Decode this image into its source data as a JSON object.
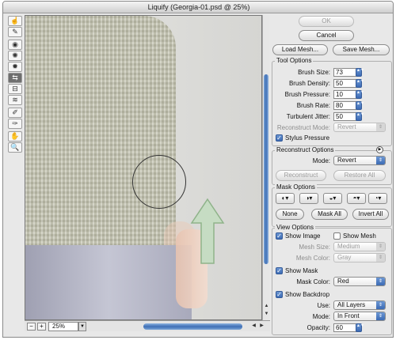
{
  "window": {
    "title": "Liquify (Georgia-01.psd @ 25%)"
  },
  "tools": [
    {
      "icon": "forward-warp-icon",
      "glyph": "☝"
    },
    {
      "icon": "reconstruct-tool-icon",
      "glyph": "✎"
    },
    {
      "icon": "twirl-clockwise-icon",
      "glyph": "◉"
    },
    {
      "icon": "pucker-icon",
      "glyph": "✺"
    },
    {
      "icon": "bloat-icon",
      "glyph": "✹"
    },
    {
      "icon": "push-left-icon",
      "glyph": "⇆"
    },
    {
      "icon": "mirror-icon",
      "glyph": "⊟"
    },
    {
      "icon": "turbulence-icon",
      "glyph": "≋"
    },
    {
      "icon": "freeze-mask-icon",
      "glyph": "✐"
    },
    {
      "icon": "thaw-mask-icon",
      "glyph": "✑"
    },
    {
      "icon": "hand-icon",
      "glyph": "✋"
    },
    {
      "icon": "zoom-icon",
      "glyph": "🔍"
    }
  ],
  "buttons": {
    "ok": "OK",
    "cancel": "Cancel",
    "load_mesh": "Load Mesh...",
    "save_mesh": "Save Mesh..."
  },
  "tool_options": {
    "title": "Tool Options",
    "brush_size_label": "Brush Size:",
    "brush_size": "73",
    "brush_density_label": "Brush Density:",
    "brush_density": "50",
    "brush_pressure_label": "Brush Pressure:",
    "brush_pressure": "10",
    "brush_rate_label": "Brush Rate:",
    "brush_rate": "80",
    "turbulent_jitter_label": "Turbulent Jitter:",
    "turbulent_jitter": "50",
    "reconstruct_mode_label": "Reconstruct Mode:",
    "reconstruct_mode": "Revert",
    "stylus_pressure_label": "Stylus Pressure",
    "stylus_pressure": true
  },
  "reconstruct_options": {
    "title": "Reconstruct Options",
    "mode_label": "Mode:",
    "mode": "Revert",
    "reconstruct_btn": "Reconstruct",
    "restore_all_btn": "Restore All"
  },
  "mask_options": {
    "title": "Mask Options",
    "mask_icons": [
      "replace-selection-icon",
      "add-to-selection-icon",
      "subtract-from-selection-icon",
      "intersect-selection-icon",
      "invert-selection-icon"
    ],
    "none_btn": "None",
    "mask_all_btn": "Mask All",
    "invert_all_btn": "Invert All"
  },
  "view_options": {
    "title": "View Options",
    "show_image_label": "Show Image",
    "show_image": true,
    "show_mesh_label": "Show Mesh",
    "show_mesh": false,
    "mesh_size_label": "Mesh Size:",
    "mesh_size": "Medium",
    "mesh_color_label": "Mesh Color:",
    "mesh_color": "Gray",
    "show_mask_label": "Show Mask",
    "show_mask": true,
    "mask_color_label": "Mask Color:",
    "mask_color": "Red",
    "show_backdrop_label": "Show Backdrop",
    "show_backdrop": true,
    "use_label": "Use:",
    "use": "All Layers",
    "mode_label": "Mode:",
    "mode": "In Front",
    "opacity_label": "Opacity:",
    "opacity": "60"
  },
  "zoom": {
    "value": "25%"
  }
}
